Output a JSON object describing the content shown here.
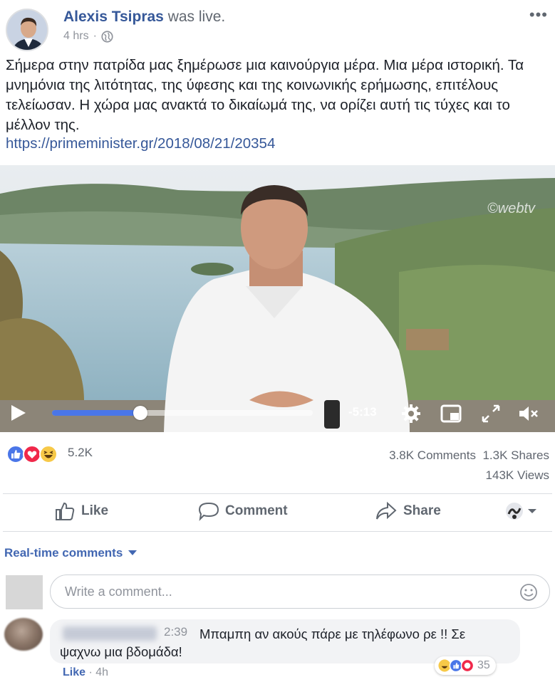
{
  "post": {
    "author": "Alexis Tsipras",
    "action": "was live.",
    "time": "4 hrs",
    "audience_icon": "globe-icon",
    "more_icon": "more-dots-icon",
    "text": "Σήμερα στην πατρίδα μας ξημέρωσε μια καινούργια μέρα. Μια μέρα ιστορική. Τα μνημόνια της λιτότητας, της ύφεσης και της κοινωνικής ερήμωσης, επιτέλους τελείωσαν. Η χώρα μας ανακτά το δικαίωμά της, να ορίζει αυτή τις τύχες και το μέλλον της.",
    "link": "https://primeminister.gr/2018/08/21/20354"
  },
  "video": {
    "watermark": "©webtv",
    "time_remaining": "-5:13",
    "progress": 0.34,
    "controls": [
      "play-icon",
      "settings-icon",
      "pip-icon",
      "fullscreen-icon",
      "mute-icon"
    ]
  },
  "reactions": {
    "icons": [
      "like-reaction-icon",
      "love-reaction-icon",
      "haha-reaction-icon"
    ],
    "count": "5.2K",
    "comments": "3.8K Comments",
    "shares": "1.3K Shares",
    "views": "143K Views"
  },
  "actions": {
    "like": "Like",
    "comment": "Comment",
    "share": "Share"
  },
  "comments_section": {
    "filter_label": "Real-time comments",
    "input_placeholder": "Write a comment..."
  },
  "comment": {
    "time": "2:39",
    "text": "Μπαμπη αν ακούς πάρε με τηλέφωνο ρε !! Σε ψαχνω μια βδομάδα!",
    "like_label": "Like",
    "age": "4h",
    "reaction_count": "35"
  },
  "colors": {
    "link_blue": "#365899",
    "action_blue": "#4267b2",
    "progress_blue": "#4a76e8",
    "muted_text": "#90949c"
  }
}
